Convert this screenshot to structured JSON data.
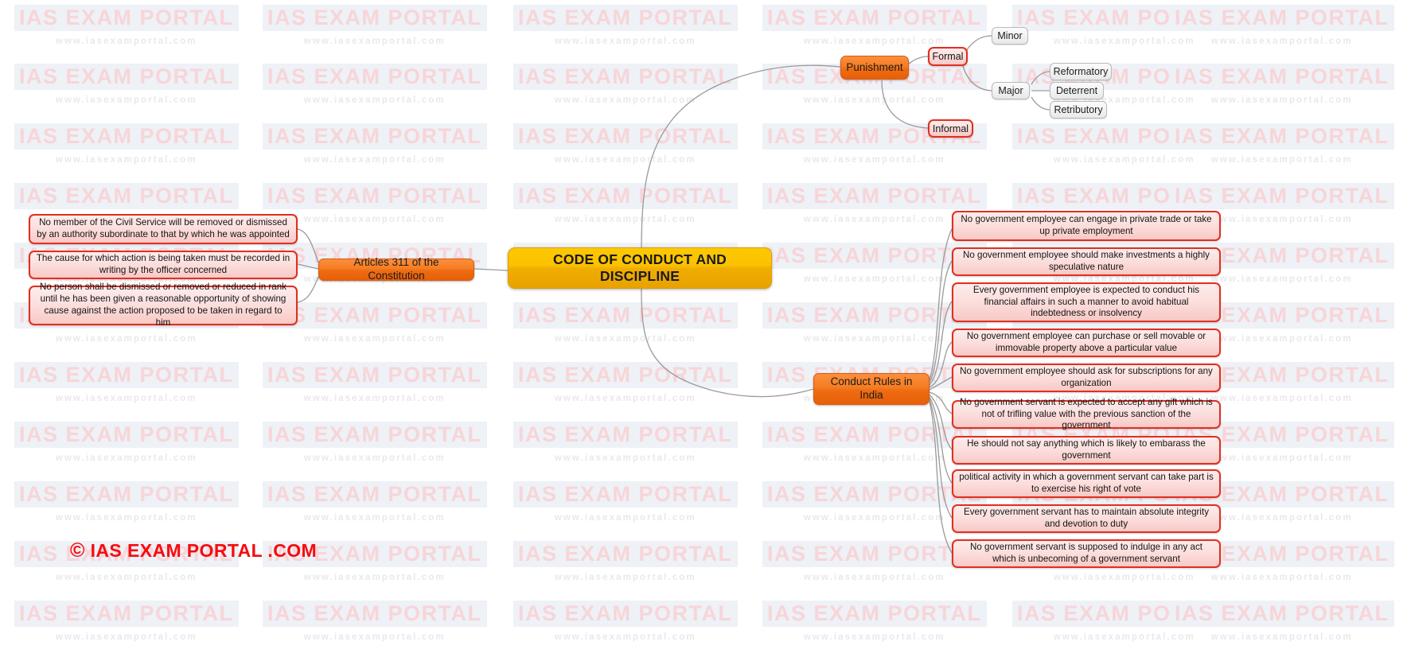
{
  "central": {
    "label": "CODE OF CONDUCT AND DISCIPLINE"
  },
  "branches": {
    "punishment": {
      "label": "Punishment"
    },
    "articles311": {
      "label": "Articles 311 of the Constitution"
    },
    "conduct_rules": {
      "label": "Conduct Rules in India"
    }
  },
  "punishment_children": {
    "formal": {
      "label": "Formal"
    },
    "informal": {
      "label": "Informal"
    },
    "minor": {
      "label": "Minor"
    },
    "major": {
      "label": "Major"
    },
    "reformatory": {
      "label": "Reformatory"
    },
    "deterrent": {
      "label": "Deterrent"
    },
    "retributory": {
      "label": "Retributory"
    }
  },
  "articles311_children": [
    {
      "label": "No member of the Civil Service will be removed or dismissed by an authority subordinate to that by which he was appointed"
    },
    {
      "label": "The cause for which action is being taken must be recorded in writing by the officer concerned"
    },
    {
      "label": "No person shall be dismissed or removed or reduced in rank until he has been given a reasonable opportunity of showing cause against the action proposed to be taken in regard to him"
    }
  ],
  "conduct_rules_children": [
    {
      "label": "No government employee can engage in private trade or take up private employment"
    },
    {
      "label": "No government employee should make investments a highly speculative nature"
    },
    {
      "label": "Every government employee is expected to conduct his financial affairs in such a  manner to avoid habitual indebtedness or insolvency"
    },
    {
      "label": "No government employee can purchase or sell movable or immovable property above a particular value"
    },
    {
      "label": "No government employee should ask for subscriptions for any organization"
    },
    {
      "label": "No government servant is expected to accept any gift which is not of trifling value with the previous sanction of the government"
    },
    {
      "label": "He should not say anything which is likely to embarass the government"
    },
    {
      "label": "political activity in which a government servant can take part is to exercise his right of vote"
    },
    {
      "label": "Every government servant has to maintain absolute integrity and devotion to duty"
    },
    {
      "label": "No government servant is supposed to indulge in any act which is unbecoming of a government servant"
    }
  ],
  "copyright": {
    "mark": "©",
    "text": "IAS EXAM PORTAL .COM"
  },
  "watermark": {
    "title": "IAS EXAM PORTAL",
    "url": "www.iasexamportal.com"
  },
  "colors": {
    "central_fill": "#fcc201",
    "branch_fill": "#f0741c",
    "leaf_fill": "#fbdedc",
    "leaf_border": "#e12f20",
    "sub_fill": "#f2f2f3",
    "connector": "#9a9a9a",
    "copyright": "#f50c10",
    "watermark_title": "#f7d5d8",
    "watermark_url": "#e9e9ec"
  }
}
